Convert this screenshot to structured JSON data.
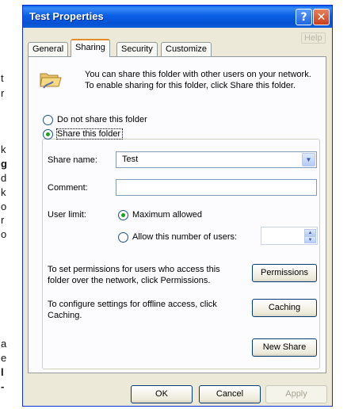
{
  "window": {
    "title": "Test Properties",
    "help_button": "?",
    "close_button": "✕",
    "help_ghost": "Help"
  },
  "tabs": [
    {
      "label": "General"
    },
    {
      "label": "Sharing"
    },
    {
      "label": "Security"
    },
    {
      "label": "Customize"
    }
  ],
  "intro_text": "You can share this folder with other users on your network.  To enable sharing for this folder, click Share this folder.",
  "options": {
    "do_not_share": "Do not share this folder",
    "share": "Share this folder"
  },
  "share_name": {
    "label": "Share name:",
    "value": "Test"
  },
  "comment": {
    "label": "Comment:",
    "value": ""
  },
  "user_limit": {
    "label": "User limit:",
    "max_allowed": "Maximum allowed",
    "allow_number": "Allow this number of users:",
    "count": ""
  },
  "permissions": {
    "text": "To set permissions for users who access this folder over the network, click Permissions.",
    "button": "Permissions"
  },
  "caching": {
    "text": "To configure settings for offline access, click Caching.",
    "button": "Caching"
  },
  "new_share_button": "New Share",
  "footer": {
    "ok": "OK",
    "cancel": "Cancel",
    "apply": "Apply"
  },
  "background_text": [
    "t",
    "r",
    "k",
    "g",
    "d",
    "k",
    "o",
    "r",
    "o",
    "a",
    "e",
    "l",
    "-"
  ]
}
